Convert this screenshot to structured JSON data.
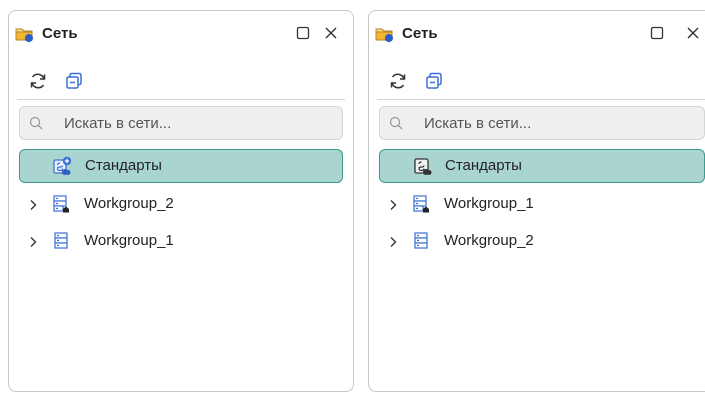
{
  "panels": [
    {
      "title": "Сеть",
      "search_placeholder": "Искать в сети...",
      "items": [
        {
          "label": "Стандарты",
          "selected": true,
          "expandable": false,
          "icon": "standards-add-icon"
        },
        {
          "label": "Workgroup_2",
          "selected": false,
          "expandable": true,
          "icon": "server-home-icon"
        },
        {
          "label": "Workgroup_1",
          "selected": false,
          "expandable": true,
          "icon": "server-icon"
        }
      ]
    },
    {
      "title": "Сеть",
      "search_placeholder": "Искать в сети...",
      "items": [
        {
          "label": "Стандарты",
          "selected": true,
          "expandable": false,
          "icon": "standards-icon"
        },
        {
          "label": "Workgroup_1",
          "selected": false,
          "expandable": true,
          "icon": "server-home-icon"
        },
        {
          "label": "Workgroup_2",
          "selected": false,
          "expandable": true,
          "icon": "server-icon"
        }
      ]
    }
  ],
  "colors": {
    "selected_bg": "#a9d4d0",
    "selected_border": "#3f9a8e",
    "icon_blue": "#3b6fd6",
    "folder_yellow": "#f2b632"
  }
}
